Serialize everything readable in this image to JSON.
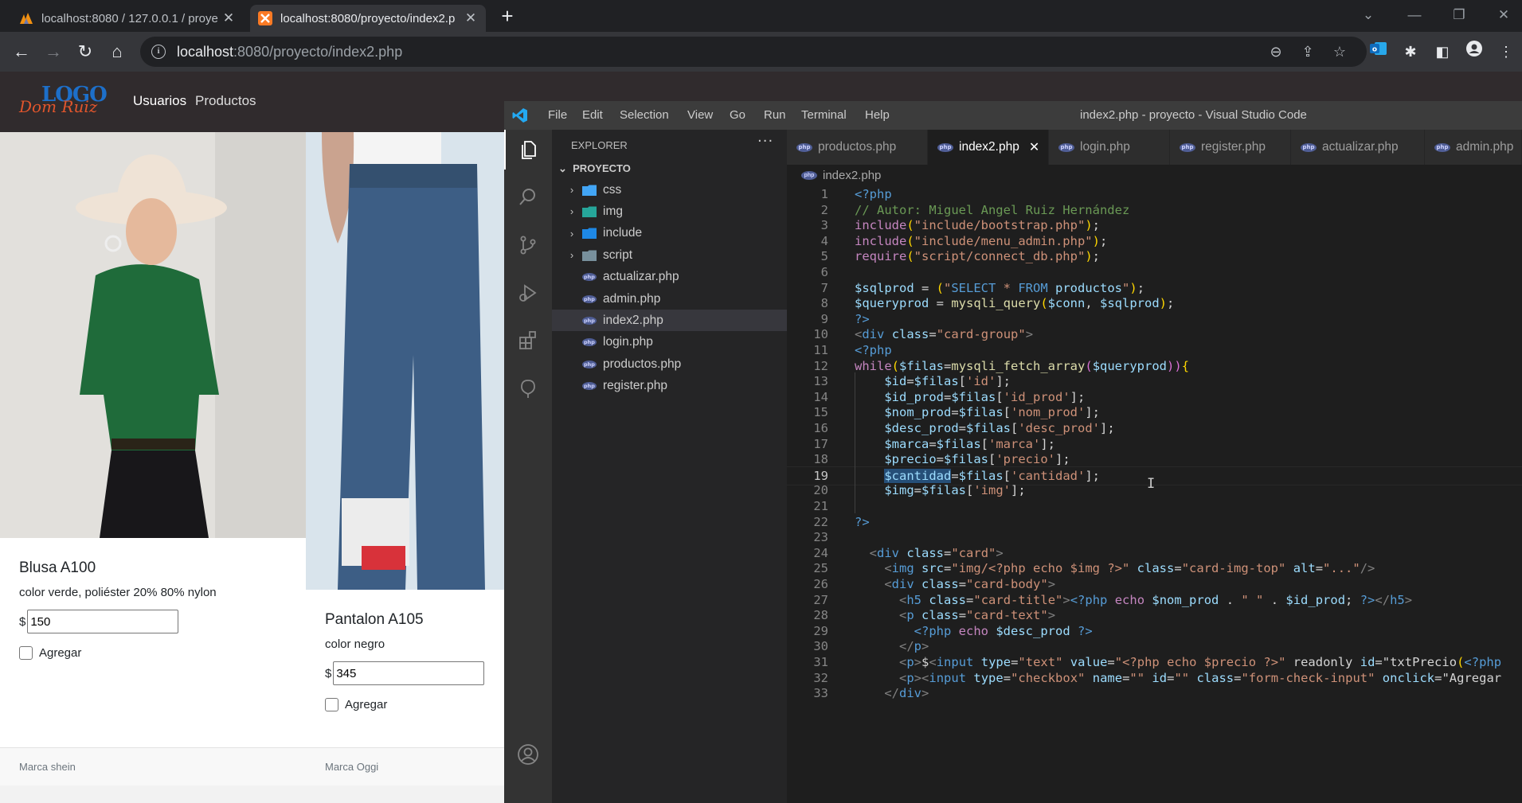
{
  "browser": {
    "tabs": [
      {
        "title": "localhost:8080 / 127.0.0.1 / proye",
        "active": false
      },
      {
        "title": "localhost:8080/proyecto/index2.p",
        "active": true
      }
    ],
    "address": {
      "host": "localhost",
      "rest": ":8080/proyecto/index2.php"
    }
  },
  "site": {
    "logo_top": "LOGO",
    "logo_bottom": "Dom Ruiz",
    "nav": [
      "Usuarios",
      "Productos"
    ],
    "cards": [
      {
        "title": "Blusa A100",
        "desc": "color verde, poliéster 20% 80% nylon",
        "currency": "$",
        "price": "150",
        "check_label": "Agregar",
        "brand": "Marca shein"
      },
      {
        "title": "Pantalon A105",
        "desc": "color negro",
        "currency": "$",
        "price": "345",
        "check_label": "Agregar",
        "brand": "Marca Oggi"
      }
    ]
  },
  "vscode": {
    "menu": [
      "File",
      "Edit",
      "Selection",
      "View",
      "Go",
      "Run",
      "Terminal",
      "Help"
    ],
    "window_title": "index2.php - proyecto - Visual Studio Code",
    "explorer_label": "EXPLORER",
    "explorer_more": "···",
    "project": "PROYECTO",
    "folders": [
      "css",
      "img",
      "include",
      "script"
    ],
    "files": [
      "actualizar.php",
      "admin.php",
      "index2.php",
      "login.php",
      "productos.php",
      "register.php"
    ],
    "selected_file": "index2.php",
    "tabs": [
      "productos.php",
      "index2.php",
      "login.php",
      "register.php",
      "actualizar.php",
      "admin.php"
    ],
    "active_tab": "index2.php",
    "php_badge": "php",
    "breadcrumb": "index2.php",
    "current_line": 19,
    "code": [
      "<?php",
      "// Autor: Miguel Angel Ruiz Hernández",
      "include(\"include/bootstrap.php\");",
      "include(\"include/menu_admin.php\");",
      "require(\"script/connect_db.php\");",
      "",
      "$sqlprod = (\"SELECT * FROM productos\");",
      "$queryprod = mysqli_query($conn, $sqlprod);",
      "?>",
      "<div class=\"card-group\">",
      "<?php",
      "while($filas=mysqli_fetch_array($queryprod)){",
      "    $id=$filas['id'];",
      "    $id_prod=$filas['id_prod'];",
      "    $nom_prod=$filas['nom_prod'];",
      "    $desc_prod=$filas['desc_prod'];",
      "    $marca=$filas['marca'];",
      "    $precio=$filas['precio'];",
      "    $cantidad=$filas['cantidad'];",
      "    $img=$filas['img'];",
      "",
      "?>",
      "",
      "  <div class=\"card\">",
      "    <img src=\"img/<?php echo $img ?>\" class=\"card-img-top\" alt=\"...\"/>",
      "    <div class=\"card-body\">",
      "      <h5 class=\"card-title\"><?php echo $nom_prod . \" \" . $id_prod; ?></h5>",
      "      <p class=\"card-text\">",
      "        <?php echo $desc_prod ?>",
      "      </p>",
      "      <p>$<input type=\"text\" value=\"<?php echo $precio ?>\" readonly id=\"txtPrecio(<?php",
      "      <p><input type=\"checkbox\" name=\"\" id=\"\" class=\"form-check-input\" onclick=\"Agregar",
      "    </div>"
    ]
  }
}
